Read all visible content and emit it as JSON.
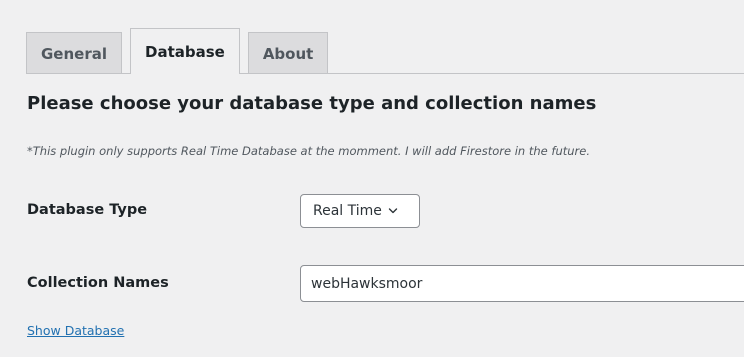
{
  "tabs": [
    {
      "label": "General",
      "active": false
    },
    {
      "label": "Database",
      "active": true
    },
    {
      "label": "About",
      "active": false
    }
  ],
  "heading": "Please choose your database type and collection names",
  "note": "*This plugin only supports Real Time Database at the momment. I will add Firestore in the future.",
  "fields": {
    "database_type": {
      "label": "Database Type",
      "selected": "Real Time",
      "icon": "chevron-down-icon"
    },
    "collection_names": {
      "label": "Collection Names",
      "value": "webHawksmoor"
    }
  },
  "show_database_link": "Show Database",
  "colors": {
    "background": "#f0f0f1",
    "link": "#2271b1",
    "border": "#8c8f94"
  }
}
